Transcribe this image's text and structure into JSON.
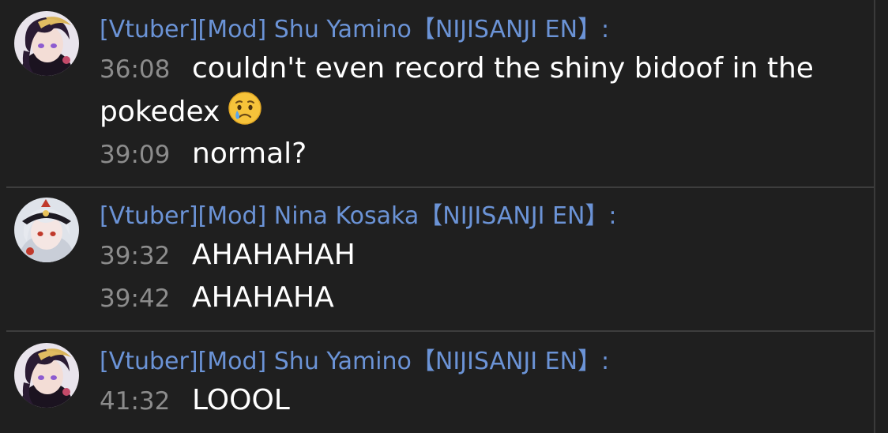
{
  "messages": [
    {
      "author": "[Vtuber][Mod] Shu Yamino【NIJISANJI EN】:",
      "avatar_icon": "shu-yamino-avatar",
      "lines": [
        {
          "time": "36:08",
          "text": "couldn't even record the shiny bidoof in the pokedex",
          "emoji": "crying-face"
        },
        {
          "time": "39:09",
          "text": "normal?"
        }
      ]
    },
    {
      "author": "[Vtuber][Mod] Nina Kosaka【NIJISANJI EN】:",
      "avatar_icon": "nina-kosaka-avatar",
      "lines": [
        {
          "time": "39:32",
          "text": "AHAHAHAH"
        },
        {
          "time": "39:42",
          "text": "AHAHAHA"
        }
      ]
    },
    {
      "author": "[Vtuber][Mod] Shu Yamino【NIJISANJI EN】:",
      "avatar_icon": "shu-yamino-avatar",
      "lines": [
        {
          "time": "41:32",
          "text": "LOOOL"
        }
      ]
    }
  ],
  "colors": {
    "background": "#1f1f1f",
    "author": "#6b93d6",
    "timestamp": "#8c8c8c",
    "text": "#ffffff",
    "divider": "#3d3d3d"
  }
}
